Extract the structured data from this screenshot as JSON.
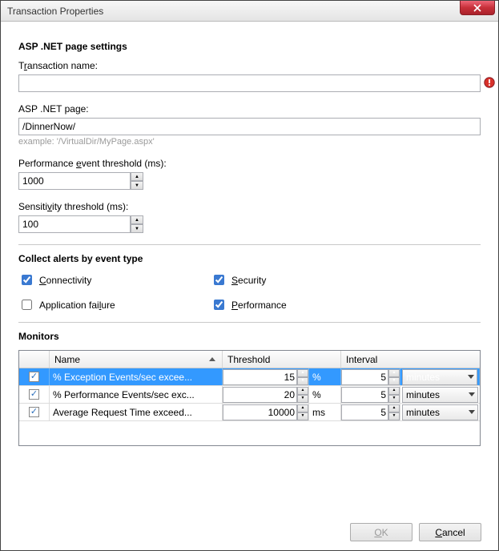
{
  "window": {
    "title": "Transaction Properties"
  },
  "sections": {
    "page_settings": "ASP .NET page settings",
    "alerts": "Collect alerts by event type",
    "monitors": "Monitors"
  },
  "fields": {
    "txn_name": {
      "label_pre": "T",
      "label_ul": "r",
      "label_post": "ansaction name:",
      "value": "",
      "has_error": true
    },
    "asp_page": {
      "label_pre": "ASP .NET pa",
      "label_ul": "g",
      "label_post": "e:",
      "value": "/DinnerNow/",
      "hint": "example: '/VirtualDir/MyPage.aspx'"
    },
    "perf_threshold": {
      "label_pre": "Performance ",
      "label_ul": "e",
      "label_post": "vent threshold (ms):",
      "value": "1000"
    },
    "sensitivity": {
      "label_pre": "Sensiti",
      "label_ul": "v",
      "label_post": "ity threshold (ms):",
      "value": "100"
    }
  },
  "alerts": {
    "connectivity": {
      "label": "Connectivity",
      "ul": "C",
      "post": "onnectivity",
      "checked": true
    },
    "appfailure": {
      "pre": "Application fai",
      "ul": "l",
      "post": "ure",
      "checked": false
    },
    "security": {
      "ul": "S",
      "post": "ecurity",
      "checked": true
    },
    "performance": {
      "ul": "P",
      "post": "erformance",
      "checked": true
    }
  },
  "monitors_table": {
    "headers": {
      "name": "Name",
      "threshold": "Threshold",
      "interval": "Interval"
    },
    "rows": [
      {
        "checked": true,
        "name": "% Exception Events/sec excee...",
        "threshold": "15",
        "unit": "%",
        "interval": "5",
        "interval_unit": "minutes",
        "selected": true
      },
      {
        "checked": true,
        "name": "% Performance Events/sec exc...",
        "threshold": "20",
        "unit": "%",
        "interval": "5",
        "interval_unit": "minutes",
        "selected": false
      },
      {
        "checked": true,
        "name": "Average Request Time exceed...",
        "threshold": "10000",
        "unit": "ms",
        "interval": "5",
        "interval_unit": "minutes",
        "selected": false
      }
    ]
  },
  "buttons": {
    "ok_ul": "O",
    "ok_post": "K",
    "cancel_ul": "C",
    "cancel_post": "ancel"
  }
}
